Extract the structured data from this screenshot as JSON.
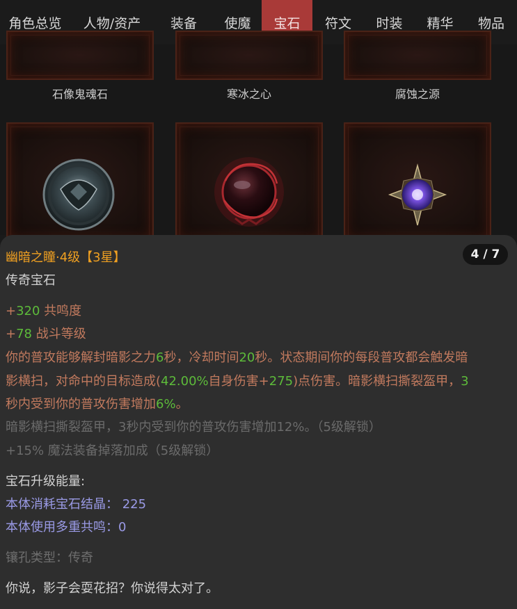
{
  "tabs": [
    {
      "label": "角色总览",
      "active": false
    },
    {
      "label": "人物/资产",
      "active": false
    },
    {
      "label": "装备",
      "active": false
    },
    {
      "label": "使魔",
      "active": false
    },
    {
      "label": "宝石",
      "active": true
    },
    {
      "label": "符文",
      "active": false
    },
    {
      "label": "时装",
      "active": false
    },
    {
      "label": "精华",
      "active": false
    },
    {
      "label": "物品",
      "active": false
    }
  ],
  "gems_top": [
    {
      "name": "石像鬼魂石"
    },
    {
      "name": "寒冰之心"
    },
    {
      "name": "腐蚀之源"
    }
  ],
  "gems_bottom": [
    {
      "icon": "dark-eye-gem-icon"
    },
    {
      "icon": "blood-orb-gem-icon"
    },
    {
      "icon": "star-crystal-gem-icon"
    }
  ],
  "detail": {
    "title": "幽暗之瞳·4级【3星】",
    "counter": "4 / 7",
    "type": "传奇宝石",
    "stat1": {
      "sign": "+",
      "value": "320",
      "label": " 共鸣度"
    },
    "stat2": {
      "sign": "+",
      "value": "78",
      "label": " 战斗等级"
    },
    "effect": {
      "p1": "你的普攻能够解封暗影之力",
      "v1": "6",
      "p2": "秒，冷却时间",
      "v2": "20",
      "p3": "秒。状态期间你的每段普攻都会触发暗",
      "p4": "影横扫，对命中的目标造成(",
      "v3": "42.00%",
      "p5": "自身伤害+",
      "v4": "275",
      "p6": ")点伤害。暗影横扫撕裂盔甲，",
      "v5": "3",
      "p7": "秒内受到你的普攻伤害增加",
      "v6": "6%",
      "p8": "。"
    },
    "locked1": "暗影横扫撕裂盔甲，3秒内受到你的普攻伤害增加12%。（5级解锁）",
    "locked2": "+15% 魔法装备掉落加成（5级解锁）",
    "upgrade_title": "宝石升级能量:",
    "upgrade1": "本体消耗宝石结晶：  225",
    "upgrade2": "本体使用多重共鸣：0",
    "socket": "镶孔类型：传奇",
    "flavor": "你说，影子会耍花招？你说得太对了。"
  },
  "colors": {
    "accent": "#a93a38",
    "title": "#f0a021",
    "green": "#5dbb3a",
    "stat": "#c27a5e",
    "blue": "#9a9ae6"
  }
}
